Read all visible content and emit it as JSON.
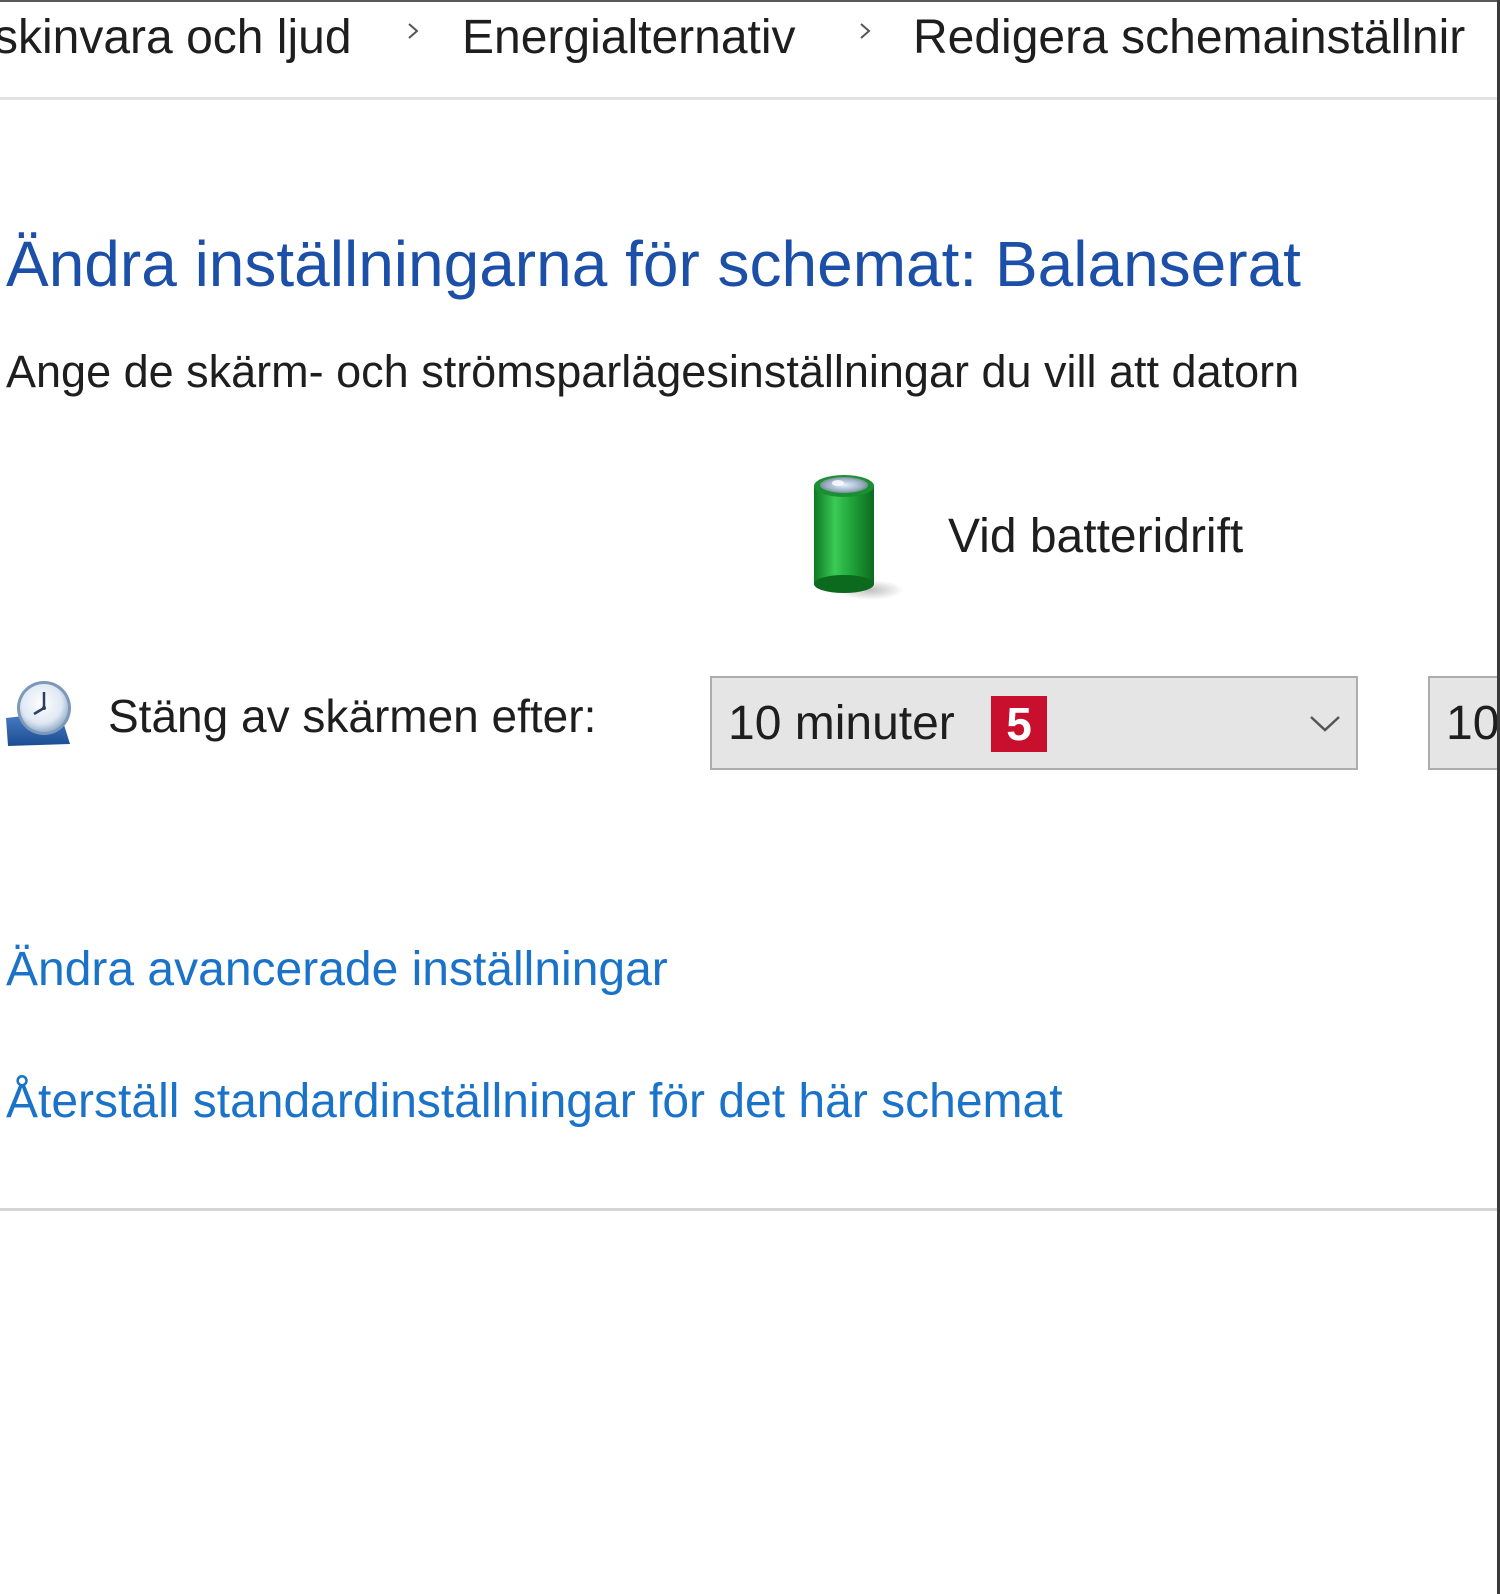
{
  "breadcrumb": {
    "items": [
      {
        "label": "skinvara och ljud"
      },
      {
        "label": "Energialternativ"
      },
      {
        "label": "Redigera schemainställnir"
      }
    ]
  },
  "header": {
    "title": "Ändra inställningarna för schemat: Balanserat",
    "subtitle": "Ange de skärm- och strömsparlägesinställningar du vill att datorn"
  },
  "columns": {
    "battery": {
      "label": "Vid batteridrift",
      "icon": "battery-icon"
    }
  },
  "settings": {
    "display_off": {
      "label": "Stäng av skärmen efter:",
      "icon": "display-clock-icon",
      "battery_value": "10 minuter",
      "badge": "5",
      "plugged_value": "10"
    }
  },
  "links": {
    "advanced": "Ändra avancerade inställningar",
    "restore": "Återställ standardinställningar för det här schemat"
  },
  "colors": {
    "title": "#1b4fa8",
    "link": "#1a73c9",
    "badge": "#c8102e",
    "battery_green": "#1fa33a"
  }
}
